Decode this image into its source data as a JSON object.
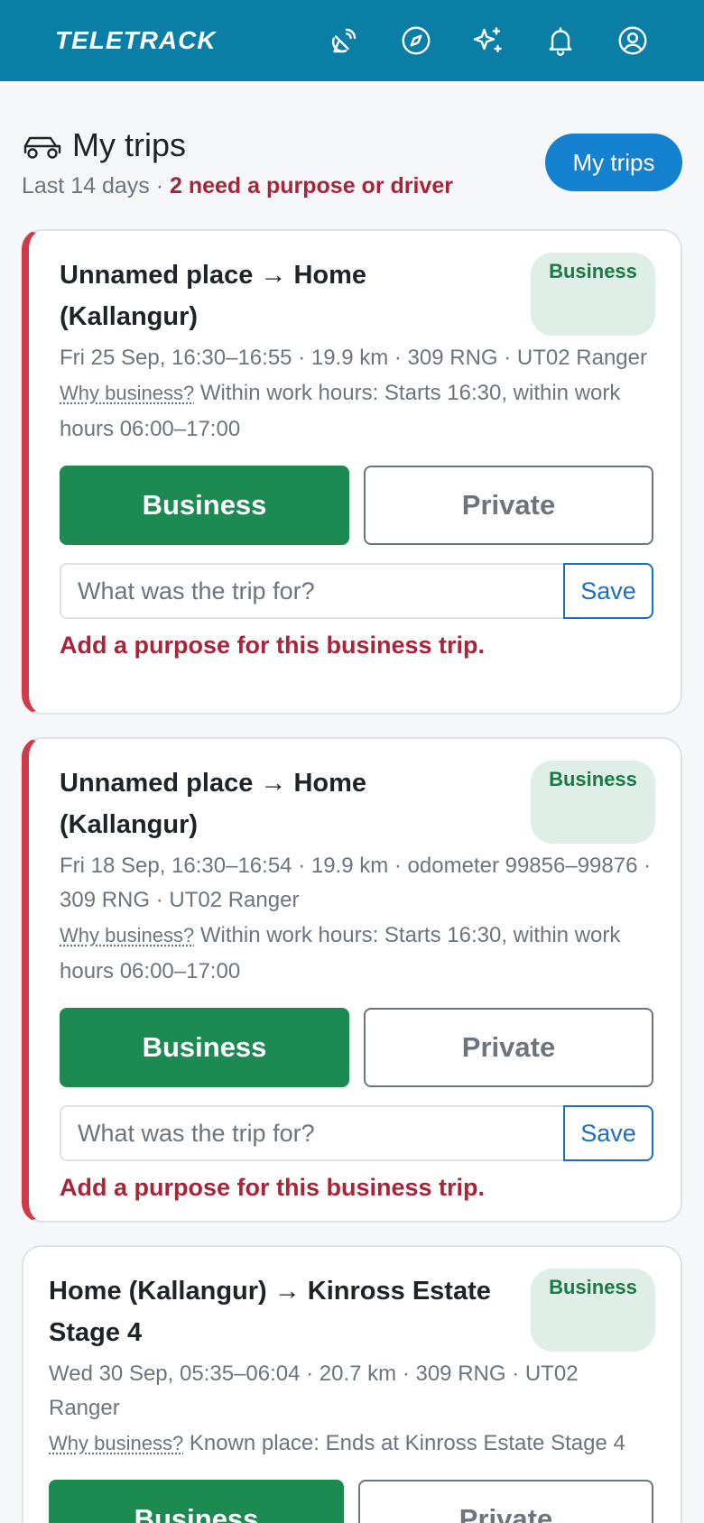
{
  "app": {
    "logo": "TELETRACK",
    "nav_icons": [
      "satellite-icon",
      "compass-icon",
      "sparkles-icon",
      "bell-icon",
      "user-circle-icon"
    ]
  },
  "header": {
    "title": "My trips",
    "subtitle_prefix": "Last 14 days · ",
    "subtitle_warning": "2 need a purpose or driver",
    "button_label": "My trips"
  },
  "trips": [
    {
      "title": "Unnamed place → Home (Kallangur)",
      "badge": "Business",
      "meta": "Fri 25 Sep, 16:30–16:55 · 19.9 km · 309 RNG · UT02 Ranger",
      "why_label": "Why business?",
      "why_text": " Within work hours: Starts 16:30, within work hours 06:00–17:00",
      "business_label": "Business",
      "private_label": "Private",
      "purpose_placeholder": "What was the trip for?",
      "save_label": "Save",
      "error": "Add a purpose for this business trip."
    },
    {
      "title": "Unnamed place → Home (Kallangur)",
      "badge": "Business",
      "meta": "Fri 18 Sep, 16:30–16:54 · 19.9 km · odometer 99856–99876 · 309 RNG · UT02 Ranger",
      "why_label": "Why business?",
      "why_text": " Within work hours: Starts 16:30, within work hours 06:00–17:00",
      "business_label": "Business",
      "private_label": "Private",
      "purpose_placeholder": "What was the trip for?",
      "save_label": "Save",
      "error": "Add a purpose for this business trip."
    },
    {
      "title": "Home (Kallangur) → Kinross Estate Stage 4",
      "badge": "Business",
      "meta": "Wed 30 Sep, 05:35–06:04 · 20.7 km · 309 RNG · UT02 Ranger",
      "why_label": "Why business?",
      "why_text": " Known place: Ends at Kinross Estate Stage 4",
      "business_label": "Business",
      "private_label": "Private"
    }
  ],
  "colors": {
    "topbar": "#0b7ea6",
    "primary": "#1581d1",
    "business": "#1d8a52",
    "warning": "#a82438",
    "flag": "#d23a48"
  }
}
